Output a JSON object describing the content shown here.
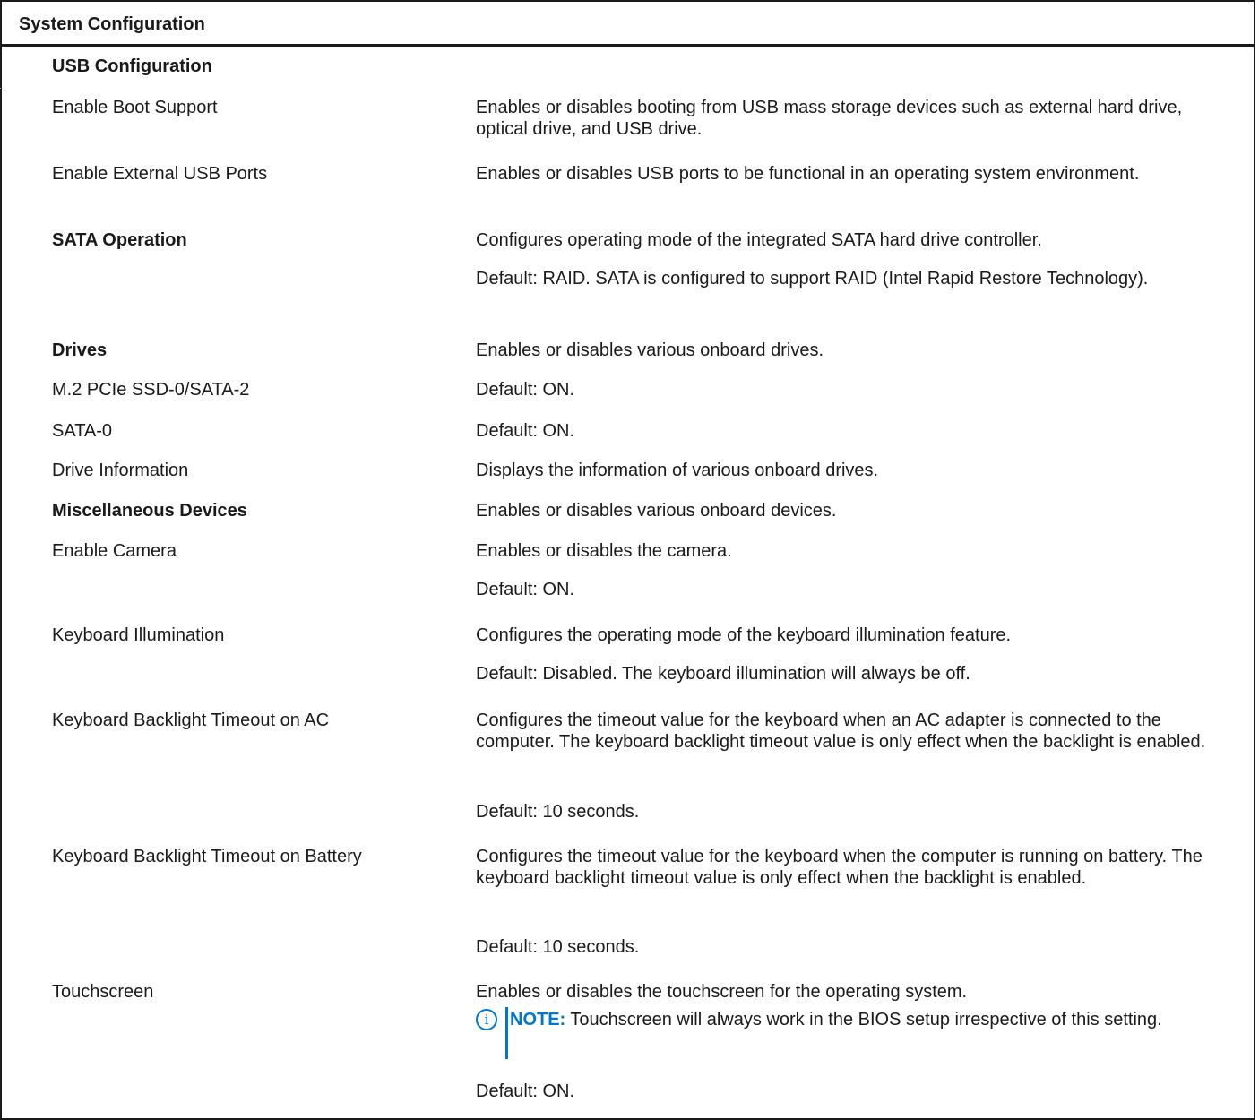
{
  "table_title": "System Configuration",
  "rows": [
    {
      "label": "USB Configuration",
      "desc": ""
    },
    {
      "label": "Enable Boot Support",
      "desc": "Enables or disables booting from USB mass storage devices such as external hard drive, optical drive, and USB drive."
    },
    {
      "label": "Enable External USB Ports",
      "desc": "Enables or disables USB ports to be functional in an operating system environment."
    },
    {
      "label": "SATA Operation",
      "desc": "Configures operating mode of the integrated SATA hard drive controller.",
      "desc2": "Default: RAID. SATA is configured to support RAID (Intel Rapid Restore Technology)."
    },
    {
      "label": "Drives",
      "desc": "Enables or disables various onboard drives."
    },
    {
      "label": "M.2 PCIe SSD-0/SATA-2",
      "desc": "Default: ON."
    },
    {
      "label": "SATA-0",
      "desc": "Default: ON."
    },
    {
      "label": "Drive Information",
      "desc": "Displays the information of various onboard drives."
    },
    {
      "label": "Miscellaneous Devices",
      "desc": "Enables or disables various onboard devices."
    },
    {
      "label": "Enable Camera",
      "desc": "Enables or disables the camera.",
      "desc2": "Default: ON."
    },
    {
      "label": "Keyboard Illumination",
      "desc": "Configures the operating mode of the keyboard illumination feature.",
      "desc2": "Default: Disabled. The keyboard illumination will always be off."
    },
    {
      "label": "Keyboard Backlight Timeout on AC",
      "desc": "Configures the timeout value for the keyboard when an AC adapter is connected to the computer. The keyboard backlight timeout value is only effect when the backlight is enabled.",
      "desc2": "Default: 10 seconds."
    },
    {
      "label": "Keyboard Backlight Timeout on Battery",
      "desc": "Configures the timeout value for the keyboard when the computer is running on battery. The keyboard backlight timeout value is only effect when the backlight is enabled.",
      "desc2": "Default: 10 seconds."
    },
    {
      "label": "Touchscreen",
      "desc": "Enables or disables the touchscreen for the operating system.",
      "note_label": "NOTE:",
      "note_text": "Touchscreen will always work in the BIOS setup irrespective of this setting.",
      "desc2": "Default: ON."
    }
  ],
  "icons": {
    "note": "info-icon",
    "note_color": "#0076ce"
  }
}
